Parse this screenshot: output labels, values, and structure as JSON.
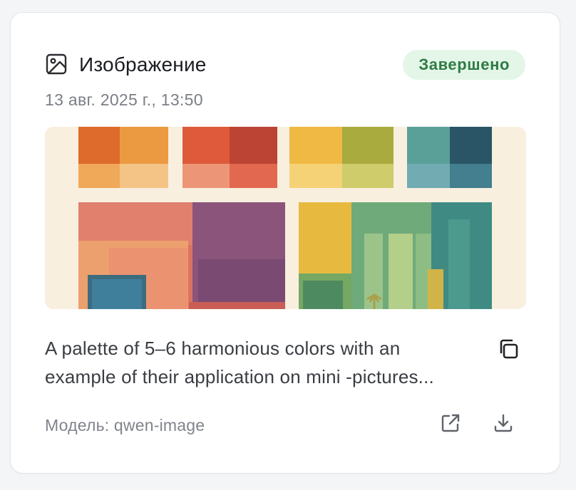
{
  "card": {
    "type_icon": "image-icon",
    "type_label": "Изображение",
    "status": "Завершено",
    "timestamp": "13 авг. 2025 г., 13:50",
    "prompt": "A palette of 5–6 harmonious colors with an example of their application on mini -pictures...",
    "model": "Модель: qwen-image"
  },
  "actions": {
    "copy_icon": "copy-icon",
    "open_icon": "external-link-icon",
    "download_icon": "download-icon"
  },
  "colors": {
    "status_bg": "#e3f6e7",
    "status_text": "#2f7a44",
    "thumbnail_bg": "#f8efdf"
  }
}
